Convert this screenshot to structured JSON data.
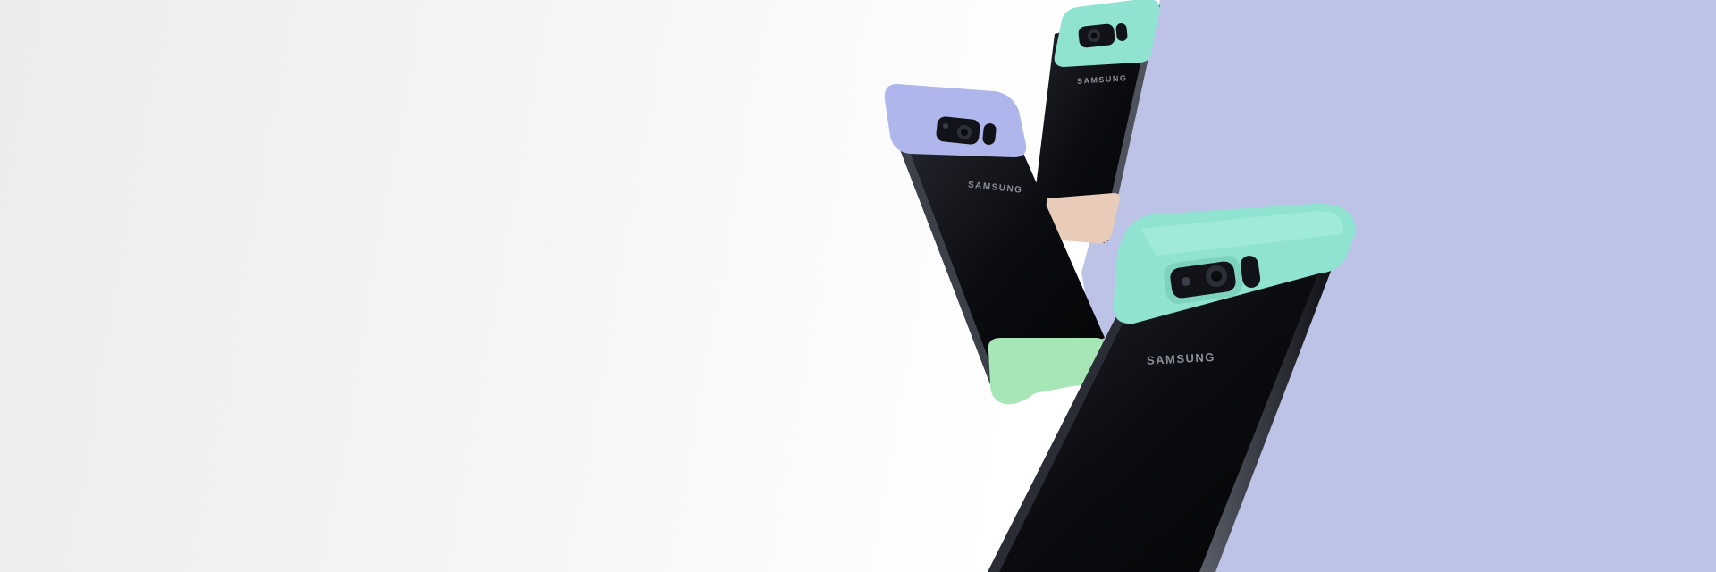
{
  "hero": {
    "colors": {
      "left_background": "#f2f2f2",
      "right_background": "#bcc3e6",
      "phone_body": "#0b0c10",
      "cap_lavender": "#aeb6ec",
      "cap_mint": "#8fe3d0",
      "cap_beige": "#e8cbb9",
      "cap_green": "#a7e6b6",
      "brand_text": "#8b8f9a"
    },
    "phones": [
      {
        "name": "back-phone",
        "brand": "SAMSUNG",
        "top_cap": "mint",
        "bottom_cap": "beige"
      },
      {
        "name": "middle-phone",
        "brand": "SAMSUNG",
        "top_cap": "lavender",
        "bottom_cap": "green"
      },
      {
        "name": "front-phone",
        "brand": "SAMSUNG",
        "top_cap": "mint"
      }
    ]
  }
}
